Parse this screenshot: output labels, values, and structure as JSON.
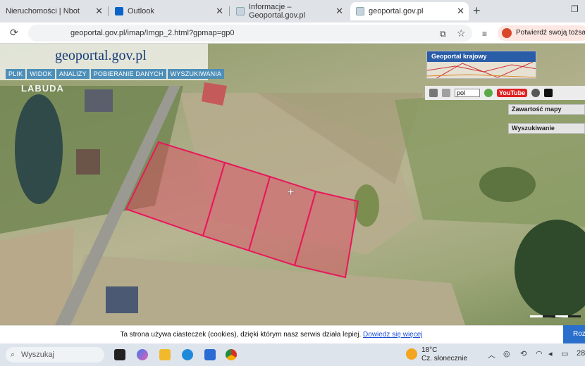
{
  "tabs": [
    {
      "label": "Nieruchomości | Nbot"
    },
    {
      "label": "Outlook"
    },
    {
      "label": "Informacje – Geoportal.gov.pl"
    },
    {
      "label": "geoportal.gov.pl"
    }
  ],
  "address_bar": {
    "url": "geoportal.gov.pl/imap/Imgp_2.html?gpmap=gp0"
  },
  "verify_identity": {
    "label": "Potwierdź swoją tożsamoś"
  },
  "geoportal": {
    "logo": "geoportal.gov.pl",
    "menu": [
      "PLIK",
      "WIDOK",
      "ANALIZY",
      "POBIERANIE DANYCH",
      "WYSZUKIWANIA"
    ],
    "place_label": "LABUDA",
    "overview_label": "Geoportal krajowy",
    "language": "pol",
    "youtube_label": "YouTube",
    "panels": {
      "map_contents": "Zawartość mapy",
      "search": "Wyszukiwanie"
    }
  },
  "cookie_bar": {
    "text": "Ta strona używa ciasteczek (cookies), dzięki którym nasz serwis działa lepiej.",
    "link": "Dowiedz się więcej",
    "button": "Roz"
  },
  "taskbar": {
    "search_placeholder": "Wyszukaj",
    "weather_temp": "18°C",
    "weather_desc": "Cz. słonecznie",
    "clock": "28"
  },
  "colors": {
    "parcel_fill": "#e0445f",
    "parcel_stroke": "#e8185a",
    "geoportal_blue": "#2a5da8",
    "menu_blue": "#4d8fb8"
  }
}
